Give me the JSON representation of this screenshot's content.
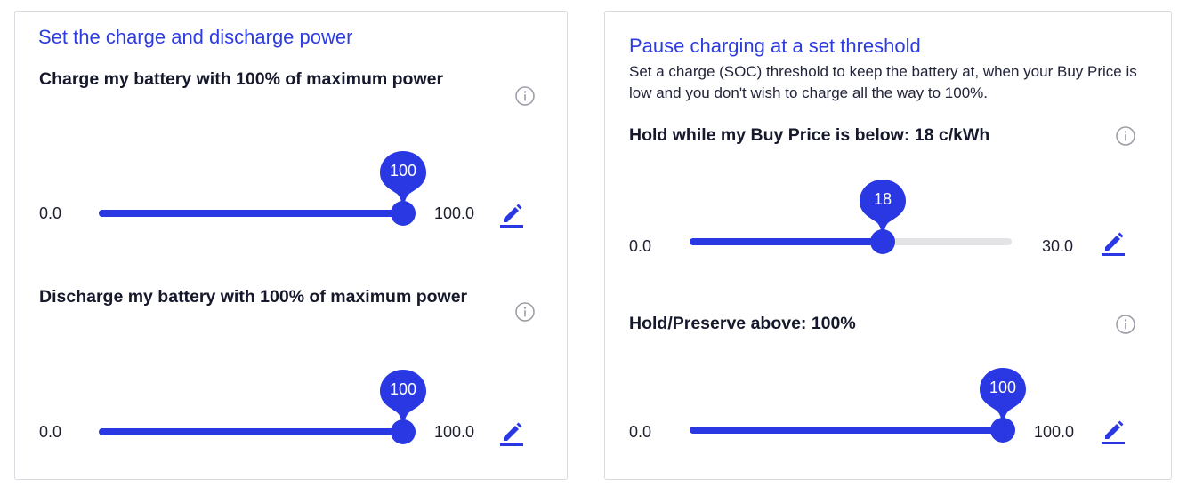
{
  "charge_discharge": {
    "title": "Set the charge and discharge power",
    "charge": {
      "label": "Charge my battery with 100% of maximum power",
      "min_label": "0.0",
      "max_label": "100.0",
      "value_label": "100",
      "value": 100,
      "min": 0,
      "max": 100
    },
    "discharge": {
      "label": "Discharge my battery with 100% of maximum power",
      "min_label": "0.0",
      "max_label": "100.0",
      "value_label": "100",
      "value": 100,
      "min": 0,
      "max": 100
    }
  },
  "pause_charging": {
    "title": "Pause charging at a set threshold",
    "description": "Set a charge (SOC) threshold to keep the battery at, when your Buy Price is low and you don't wish to charge all the way to 100%.",
    "buy_price": {
      "label": "Hold while my Buy Price is below: 18 c/kWh",
      "min_label": "0.0",
      "max_label": "30.0",
      "value_label": "18",
      "value": 18,
      "min": 0,
      "max": 30
    },
    "preserve": {
      "label": "Hold/Preserve above: 100%",
      "min_label": "0.0",
      "max_label": "100.0",
      "value_label": "100",
      "value": 100,
      "min": 0,
      "max": 100
    }
  },
  "icons": {
    "info": "info-circle-icon",
    "edit": "pencil-icon"
  },
  "colors": {
    "accent": "#2938e3",
    "title": "#2d3ce0",
    "track": "#e3e3e6",
    "info_icon": "#9a9ca6"
  }
}
